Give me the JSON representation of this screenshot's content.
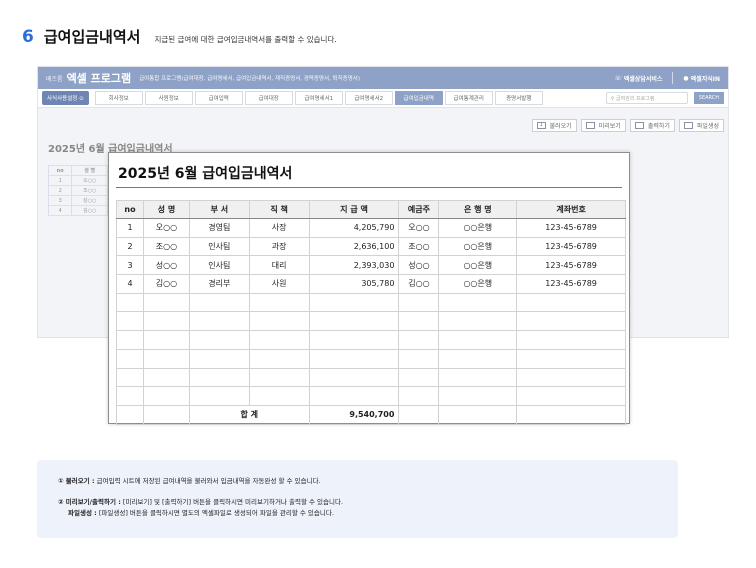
{
  "header": {
    "step_number": "6",
    "title": "급여입금내역서",
    "description": "지급된 급여에 대한 급여입금내역서를 출력할 수 있습니다."
  },
  "app": {
    "brand_small": "배즈룸",
    "brand": "엑셀 프로그램",
    "brand_sub": "급여통합 프로그램(급여대장, 급여명세서, 급여입금내역서, 재직증명서, 경력증명서, 퇴직증명서)",
    "top_links": [
      "엑셀상담서비스",
      "엑셀지식IN"
    ],
    "nav_select": "사식사용설정",
    "nav_tabs": [
      "회사정보",
      "사원정보",
      "급여입력",
      "급여대장",
      "급여명세서1",
      "급여명세서2",
      "급여입금내역",
      "급여통계관리",
      "증명서발행"
    ],
    "active_tab_index": 6,
    "search_placeholder": "급여관리 프로그램",
    "search_button": "SEARCH",
    "actions": [
      "불러오기",
      "미리보기",
      "출력하기",
      "파일생성"
    ],
    "bg_title": "2025년 6월 급여입금내역서",
    "bg_table": {
      "headers": [
        "no",
        "성 명"
      ],
      "rows": [
        [
          "1",
          "오○○"
        ],
        [
          "2",
          "조○○"
        ],
        [
          "3",
          "성○○"
        ],
        [
          "4",
          "김○○"
        ]
      ]
    }
  },
  "report": {
    "title": "2025년 6월 급여입금내역서",
    "headers": [
      "no",
      "성 명",
      "부 서",
      "직 책",
      "지 급 액",
      "예금주",
      "은 행 명",
      "계좌번호"
    ],
    "rows": [
      [
        "1",
        "오○○",
        "경영팀",
        "사장",
        "4,205,790",
        "오○○",
        "○○은행",
        "123-45-6789"
      ],
      [
        "2",
        "조○○",
        "인사팀",
        "과장",
        "2,636,100",
        "조○○",
        "○○은행",
        "123-45-6789"
      ],
      [
        "3",
        "성○○",
        "인사팀",
        "대리",
        "2,393,030",
        "성○○",
        "○○은행",
        "123-45-6789"
      ],
      [
        "4",
        "김○○",
        "경리부",
        "사원",
        "305,780",
        "김○○",
        "○○은행",
        "123-45-6789"
      ]
    ],
    "empty_rows": 6,
    "total_label": "합 계",
    "total_value": "9,540,700"
  },
  "notes": [
    {
      "label": "① 불러오기 :",
      "text": "급여입력 시트에 저장된 급여내역을 불러와서 입금내역을 자동완성 할 수 있습니다."
    },
    {
      "label": "② 미리보기/출력하기 :",
      "text": "[미리보기] 및 [출력하기] 버튼을 클릭하시면 미리보기하거나 출력할 수 있습니다."
    },
    {
      "label": "파일생성 :",
      "text": "[파일생성] 버튼을 클릭하시면 별도의 엑셀파일로 생성되어 파일을 관리할 수 있습니다."
    }
  ]
}
